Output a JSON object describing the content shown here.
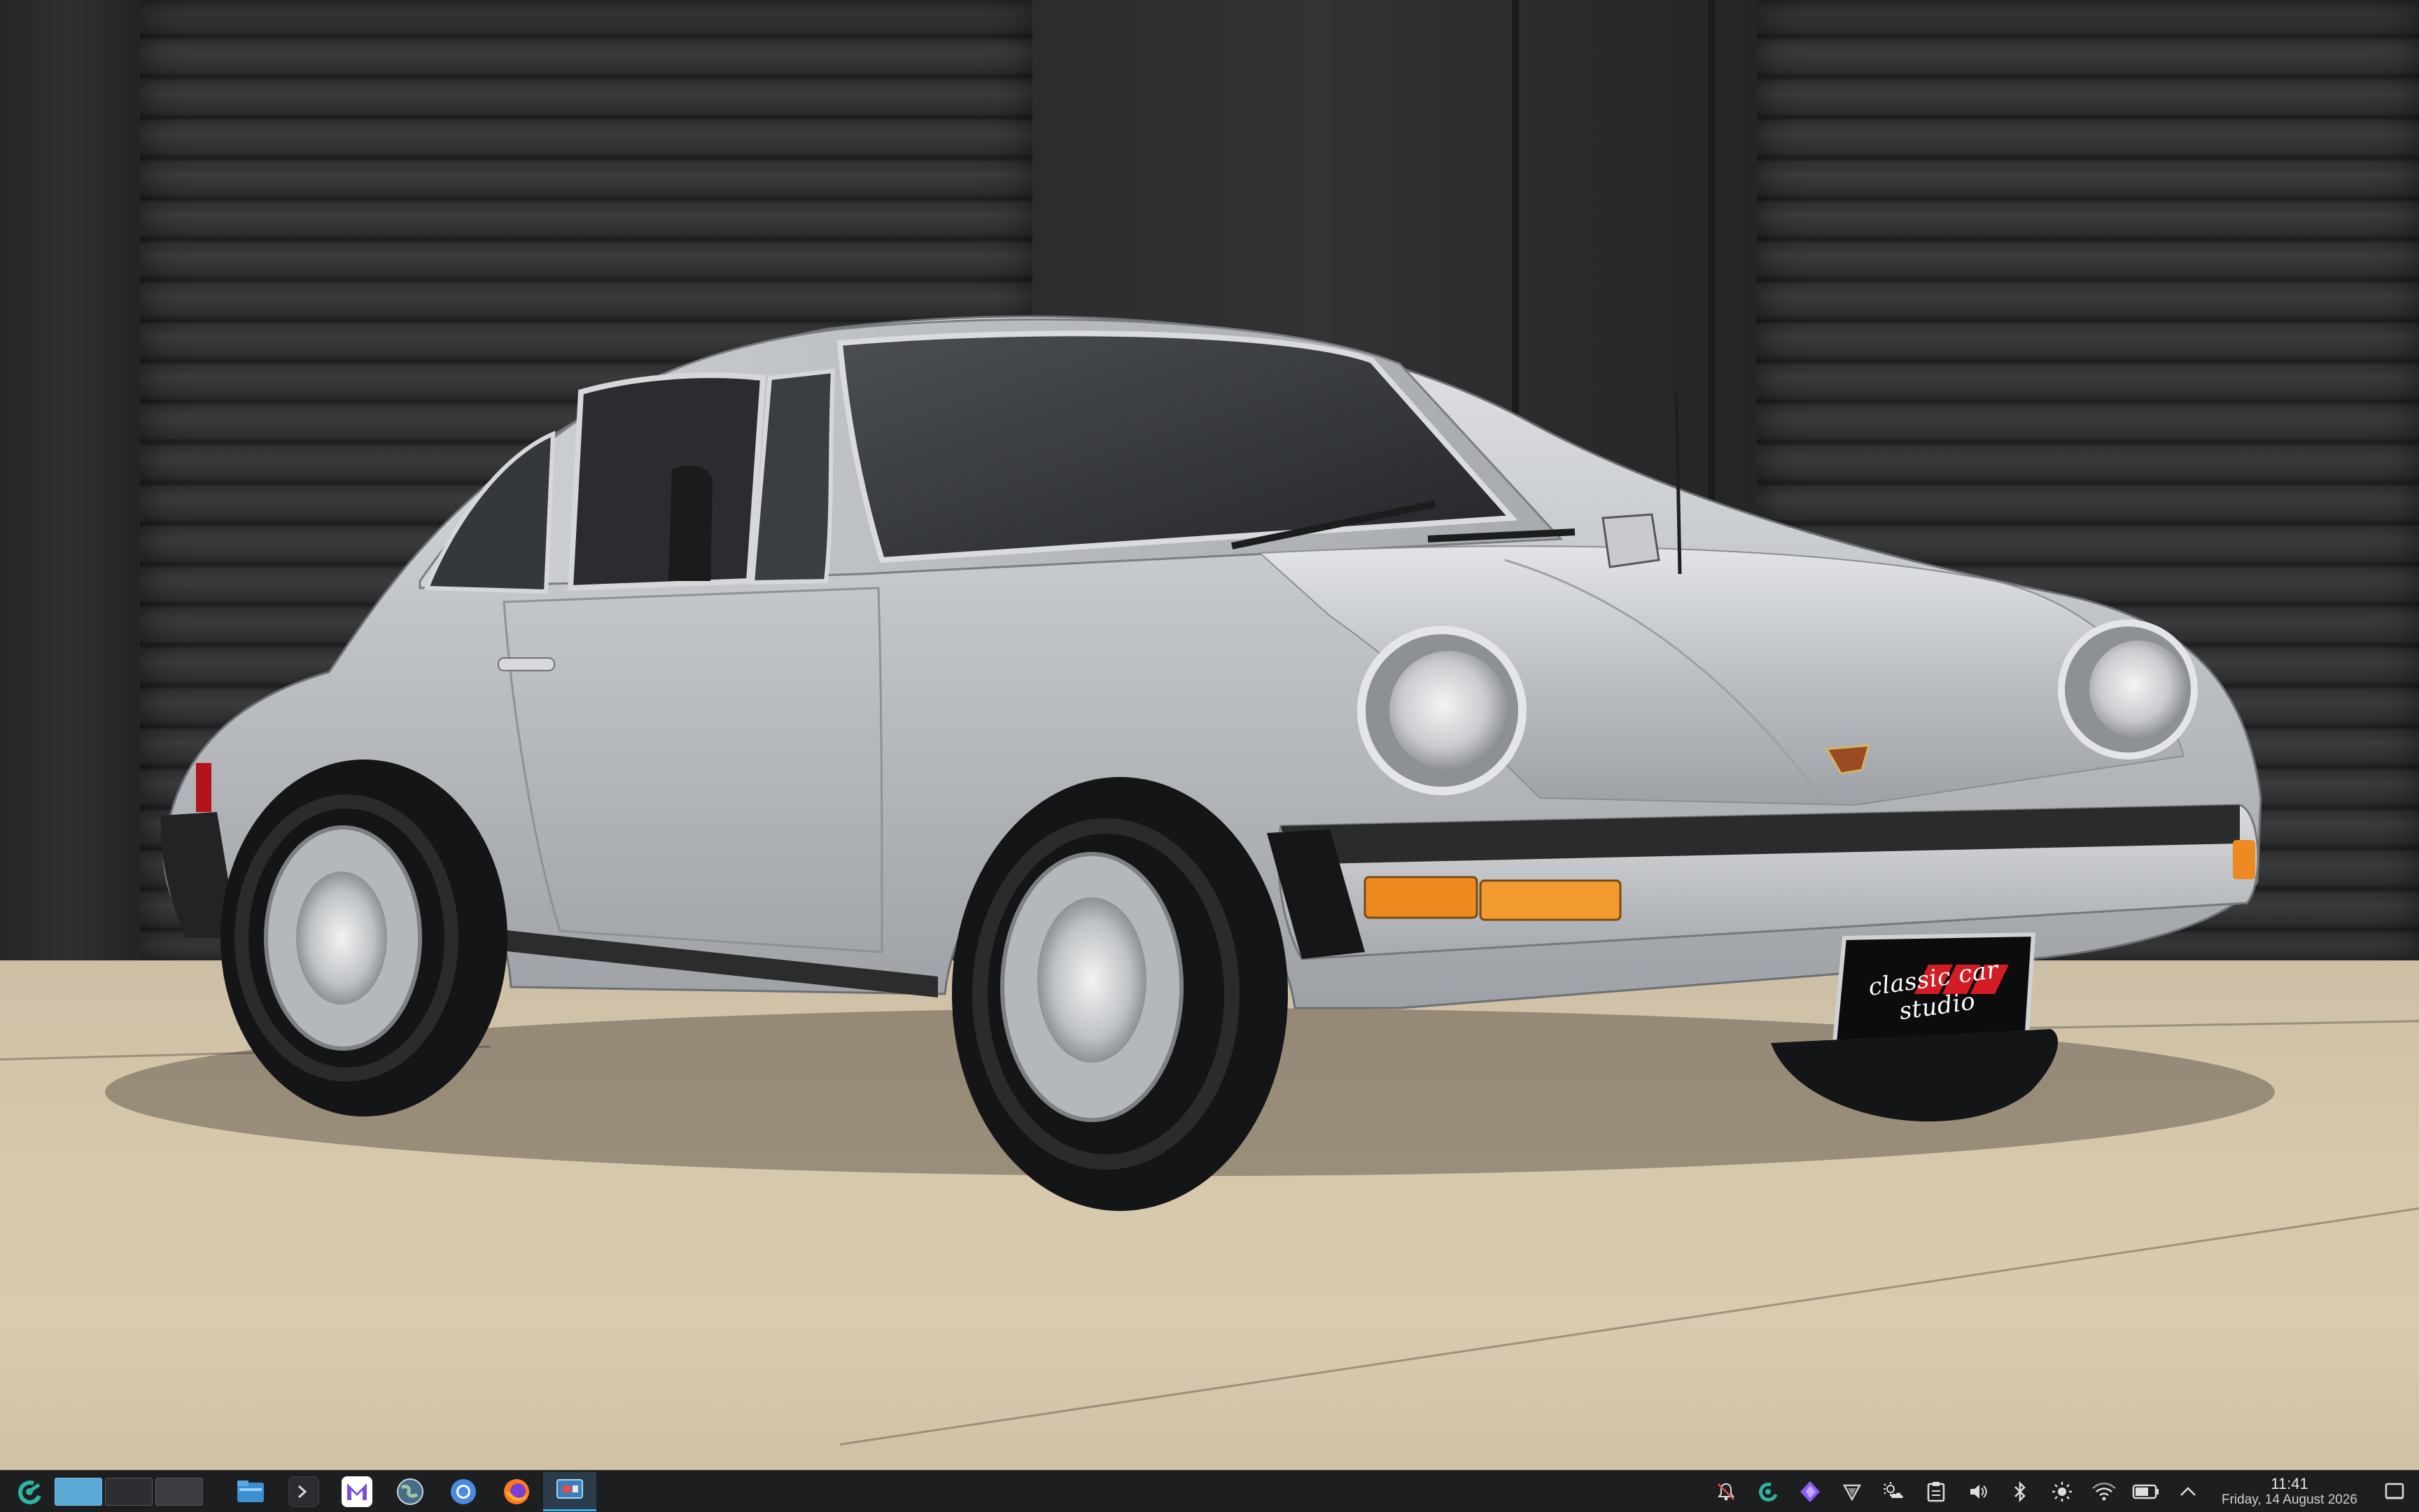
{
  "wallpaper": {
    "description_plate": "classic car studio"
  },
  "taskbar": {
    "launcher_icon": "kde-launcher-icon",
    "pager": {
      "desktops": [
        {
          "active": true
        },
        {
          "active": false
        },
        {
          "active": false
        }
      ]
    },
    "tasks": [
      {
        "icon": "file-manager-icon",
        "active": false
      },
      {
        "icon": "terminal-icon",
        "active": false
      },
      {
        "icon": "email-client-icon",
        "active": false
      },
      {
        "icon": "globe-app-icon",
        "active": false
      },
      {
        "icon": "chromium-icon",
        "active": false
      },
      {
        "icon": "firefox-icon",
        "active": false
      },
      {
        "icon": "screen-capture-icon",
        "active": true
      }
    ],
    "tray": [
      "notifications-off-icon",
      "kde-connect-icon",
      "obsidian-icon",
      "vpn-icon",
      "weather-icon",
      "clipboard-icon",
      "volume-icon",
      "bluetooth-icon",
      "brightness-icon",
      "wifi-icon",
      "battery-icon",
      "expand-tray-icon"
    ],
    "clock": {
      "time": "11:41",
      "date": "Friday, 14 August 2026"
    },
    "show_desktop_icon": "show-desktop-icon"
  },
  "colors": {
    "taskbar_bg": "#1d1e20",
    "accent": "#3daee9",
    "car_silver": "#b9bcc0"
  }
}
